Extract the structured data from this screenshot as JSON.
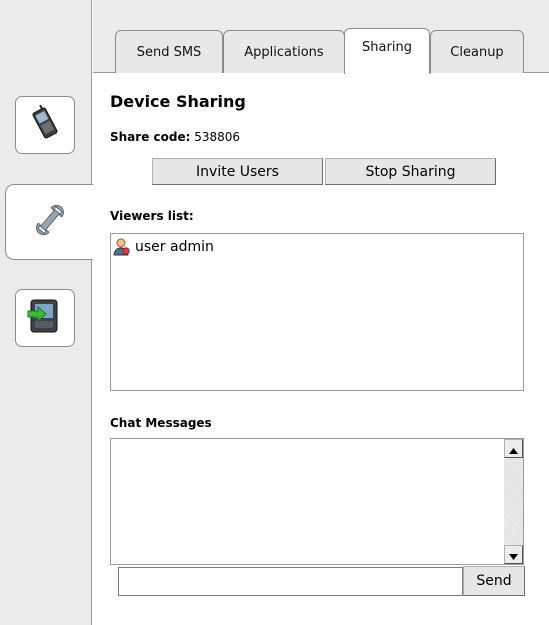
{
  "tabs": [
    {
      "label": "Send SMS"
    },
    {
      "label": "Applications"
    },
    {
      "label": "Sharing"
    },
    {
      "label": "Cleanup"
    }
  ],
  "sidebar": {
    "items": [
      {
        "icon": "mobile-phone-icon"
      },
      {
        "icon": "wrench-icon"
      },
      {
        "icon": "device-transfer-icon"
      }
    ]
  },
  "sharing": {
    "title": "Device Sharing",
    "share_code_label": "Share code:",
    "share_code_value": "538806",
    "invite_button": "Invite Users",
    "stop_button": "Stop Sharing",
    "viewers_label": "Viewers list:",
    "viewers": [
      {
        "name": "user admin",
        "icon": "user-icon"
      }
    ],
    "chat_label": "Chat Messages",
    "chat_input_value": "",
    "send_button": "Send"
  }
}
